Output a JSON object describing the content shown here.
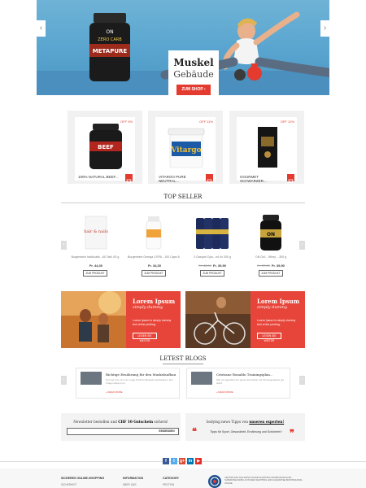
{
  "hero": {
    "title": "Muskel",
    "subtitle": "Gebäude",
    "shop_button": "ZUM SHOP",
    "shop_arrow": "›",
    "prev": "‹",
    "next": "›",
    "product_brand": "ON",
    "product_line1": "ZERO CARB",
    "product_line2": "METAPURE"
  },
  "featured_products": [
    {
      "name": "100% NATURAL BEEF...",
      "discount": "OFF 9%",
      "img_label": "BEEF"
    },
    {
      "name": "VITARGO PURE NEUTRAL...",
      "discount": "OFF 11%",
      "img_label": "Vitargo"
    },
    {
      "name": "GOURMET SCHWARZER...",
      "discount": "OFF 12%",
      "img_label": ""
    }
  ],
  "top_seller": {
    "title": "TOP SELLER",
    "prev": "‹",
    "next": "›",
    "items": [
      {
        "name": "Burgerstein hair&nails - 60 Tabl. 83 g",
        "old_price": "",
        "price": "Fr. 44,30",
        "button": "ZUM PRODUKT",
        "img_label": "hair & nails"
      },
      {
        "name": "Burgerstein Omega 3 EPA - 100 Caps 84 g",
        "old_price": "",
        "price": "Fr. 34,30",
        "button": "ZUM PRODUKT",
        "img_label": ""
      },
      {
        "name": "3 Gaspari Cyto...nd 4x 300 g",
        "old_price": "Fr. 48,90",
        "price": "Fr. 39,90",
        "button": "ZUM PRODUKT",
        "img_label": ""
      },
      {
        "name": "ON Gol... Whey ...300 g",
        "old_price": "Fr. 57,90",
        "price": "Fr. 39,90",
        "button": "ZUM PRODUKT",
        "img_label": "ON"
      }
    ]
  },
  "promos": [
    {
      "heading": "Lorem Ipsum",
      "sub": "simply dummy.",
      "desc": "Lorem Ipsum is simply dummy text of the printing.",
      "button": "LESEN SIE WEITER"
    },
    {
      "heading": "Lorem Ipsum",
      "sub": "simply dummy.",
      "desc": "Lorem Ipsum is simply dummy text of the printing.",
      "button": "LESEN SIE WEITER"
    }
  ],
  "blogs": {
    "title": "LETEST BLOGS",
    "prev": "‹",
    "next": "›",
    "items": [
      {
        "title": "Richtige Ernährung für den Muskelaufbau",
        "desc": "Nur wer isst, ist in der Lage Kraft für Muskeln aufzubauen. Die Fragen lautet nun.",
        "more": "» READ MORE"
      },
      {
        "title": "Cristiano Ronaldo Trainingsplan...",
        "desc": "Wer ist eigentlich der ganze Zeit daran mit Fitnessgedanke gut drauf.",
        "more": "» READ MORE"
      }
    ]
  },
  "newsletter": {
    "text_pre": "Newsletter bestellen und ",
    "text_bold": "CHF 10 Gutschein",
    "text_post": " sichern!",
    "placeholder": "",
    "button": "EINSENDEN"
  },
  "quote": {
    "text_pre": "bodying news Tipps von ",
    "text_bold": "unseren experten!",
    "body": "Tipps für Sport, Gesundheit, Ernährung und Schönheit !",
    "open": "❝",
    "close": "❞"
  },
  "social": [
    {
      "label": "f",
      "color": "#3b5998"
    },
    {
      "label": "t",
      "color": "#55acee"
    },
    {
      "label": "g+",
      "color": "#dd4b39"
    },
    {
      "label": "in",
      "color": "#0077b5"
    },
    {
      "label": "▶",
      "color": "#e52d27"
    }
  ],
  "footer": {
    "columns": [
      {
        "heading": "SICHERES ONLINE-SHOPPING",
        "item": "SICHERHEIT"
      },
      {
        "heading": "INFORMATION",
        "item": "ÜBER UNS"
      },
      {
        "heading": "CATEGORY",
        "item": "PROTEIN"
      }
    ],
    "badge_text": "CERTIFICATE THE SWISS ONLINE SHOPPING PROFESSIONALISM. SUPERVISE SWISS-OUTLINER SHOPPING AND GUARANTEE BODYBUILDING ONLINE."
  }
}
